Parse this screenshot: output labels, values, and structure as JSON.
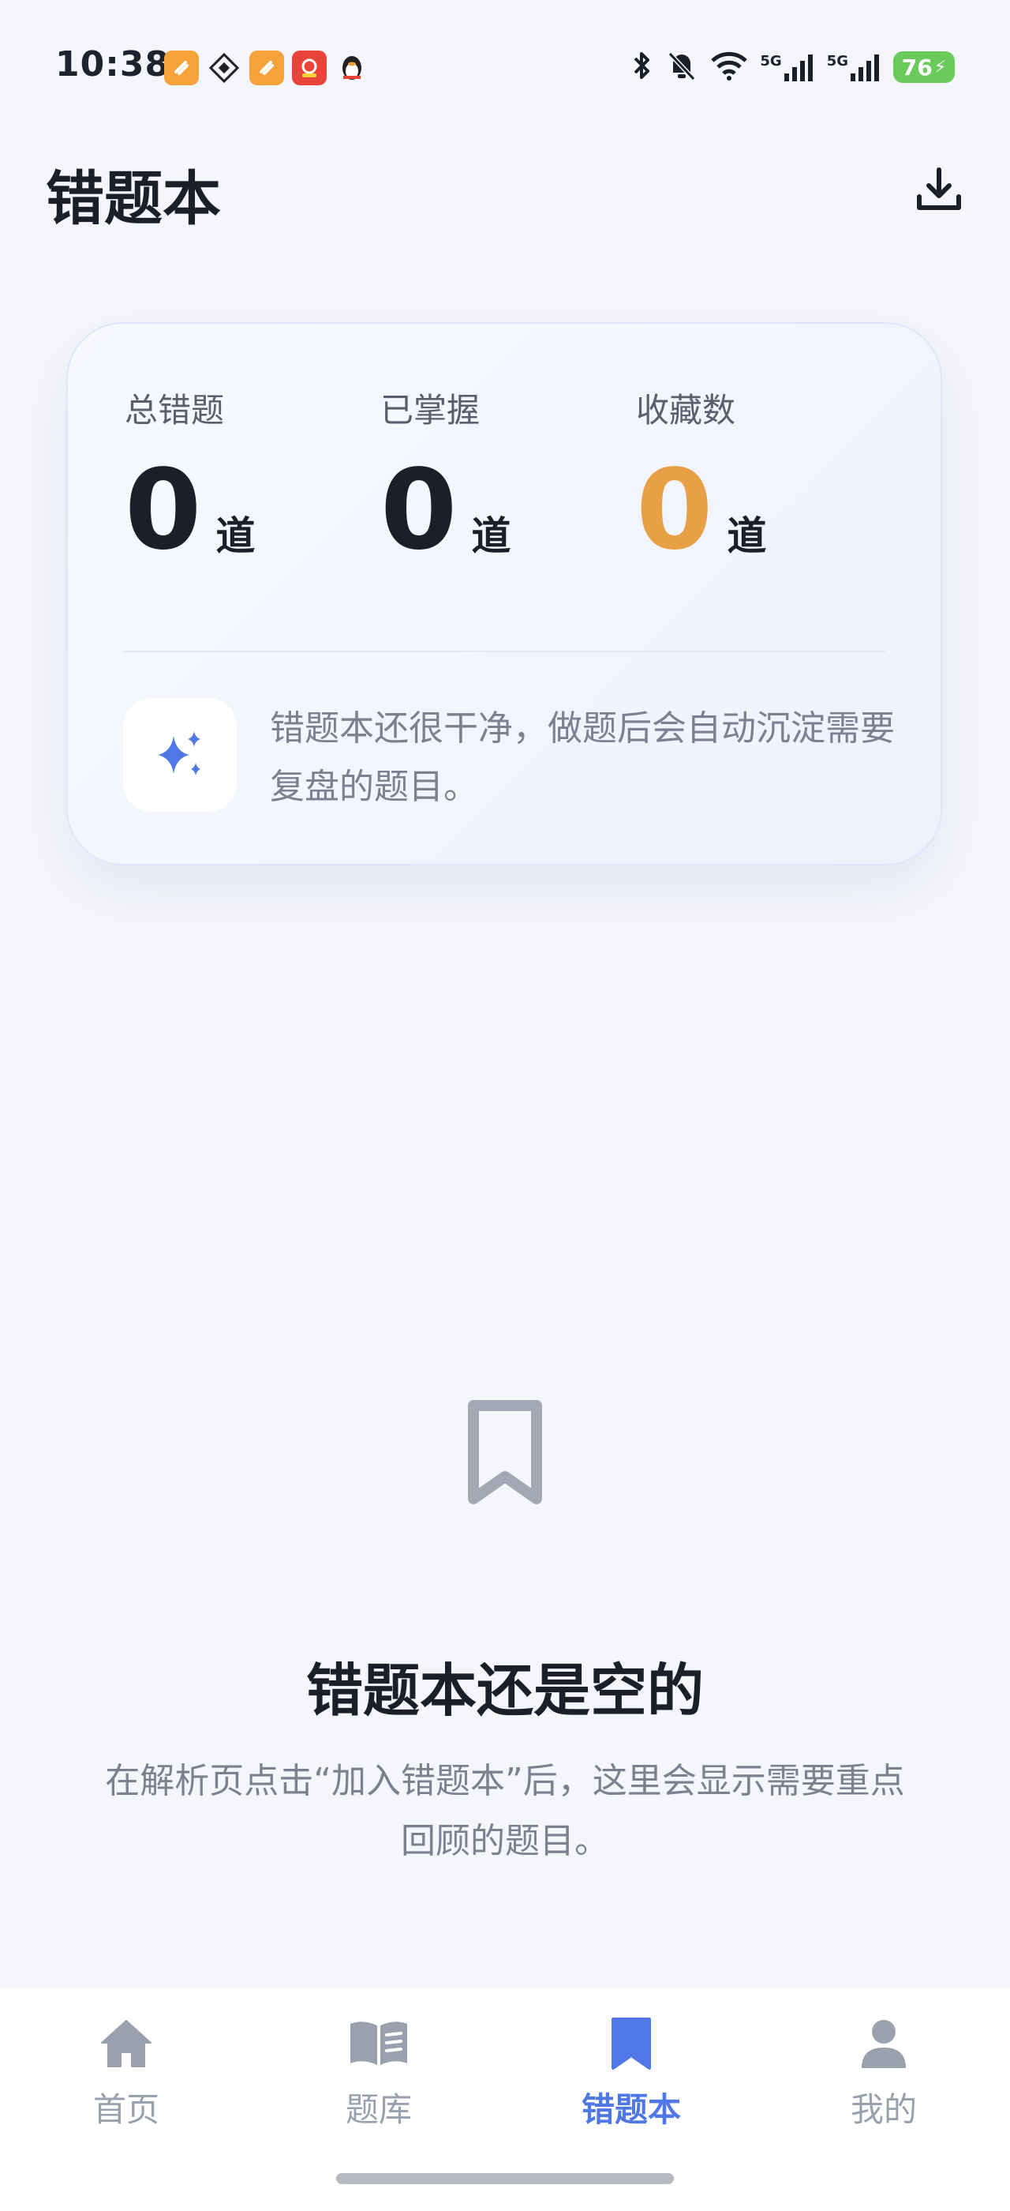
{
  "status_bar": {
    "time": "10:38",
    "left_icons": [
      "app-icon-orange",
      "grid-app-icon",
      "app-icon-orange",
      "shopping-app-icon",
      "qq-penguin-icon"
    ],
    "right_icons": [
      "bluetooth-icon",
      "mute-bell-icon",
      "wifi-icon",
      "5g-signal-icon",
      "5g-signal-icon"
    ],
    "signal_label": "5G",
    "battery": "76"
  },
  "header": {
    "title": "错题本",
    "download_icon": "download-icon"
  },
  "stats": {
    "items": [
      {
        "label": "总错题",
        "value": "0",
        "unit": "道"
      },
      {
        "label": "已掌握",
        "value": "0",
        "unit": "道"
      },
      {
        "label": "收藏数",
        "value": "0",
        "unit": "道"
      }
    ],
    "highlight_color": "#e7a045",
    "tip_icon": "sparkle-icon",
    "tip_text": "错题本还很干净，做题后会自动沉淀需要复盘的题目。"
  },
  "empty_state": {
    "icon": "bookmark-outline-icon",
    "title": "错题本还是空的",
    "description": "在解析页点击“加入错题本”后，这里会显示需要重点回顾的题目。"
  },
  "bottom_nav": {
    "active_color": "#4f78e6",
    "items": [
      {
        "label": "首页",
        "icon": "home-icon",
        "active": false
      },
      {
        "label": "题库",
        "icon": "book-icon",
        "active": false
      },
      {
        "label": "错题本",
        "icon": "bookmark-icon",
        "active": true
      },
      {
        "label": "我的",
        "icon": "user-icon",
        "active": false
      }
    ]
  }
}
